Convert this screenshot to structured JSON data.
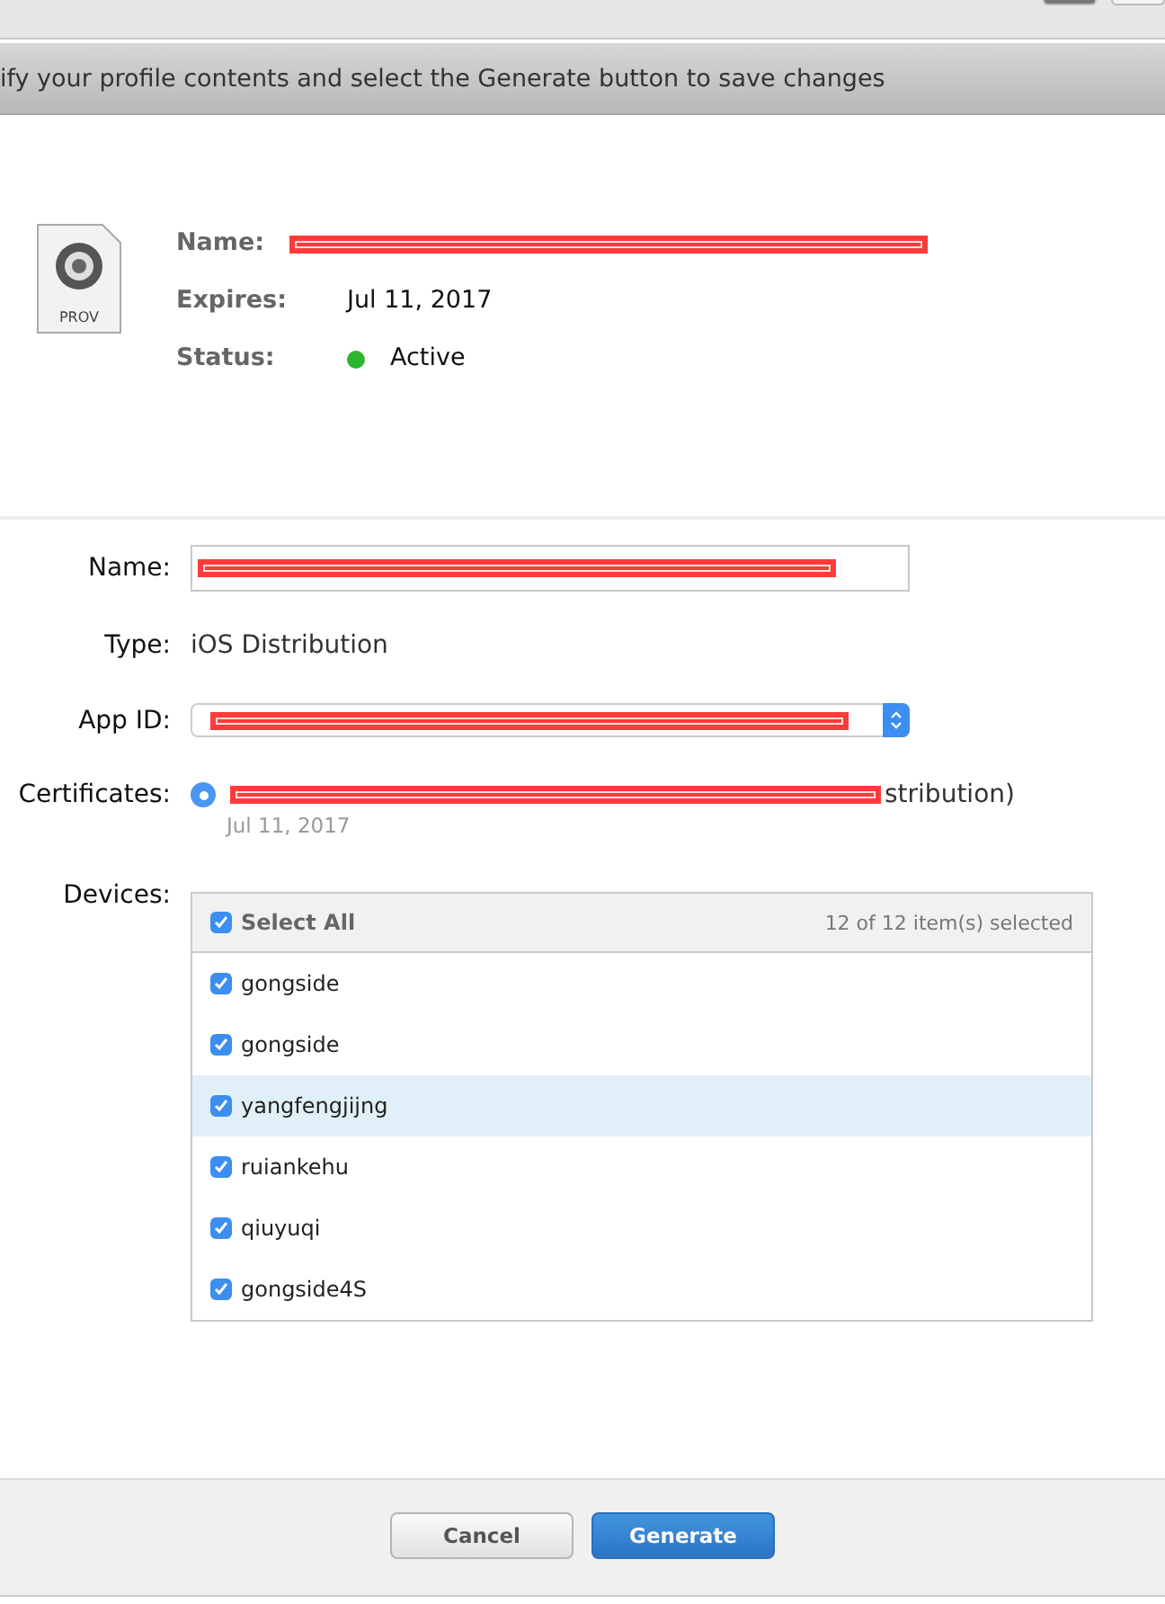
{
  "header": {
    "instruction": "ify your profile contents and select the Generate button to save changes"
  },
  "profile": {
    "icon_label": "PROV",
    "fields": [
      {
        "kind": "redacted",
        "label": "Name:"
      },
      {
        "kind": "text",
        "label": "Expires:",
        "value": "Jul 11, 2017"
      },
      {
        "kind": "status",
        "label": "Status:",
        "value": "Active",
        "color": "#2db52d"
      }
    ]
  },
  "form": {
    "name_label": "Name:",
    "type_label": "Type:",
    "type_value": "iOS Distribution",
    "app_id_label": "App ID:",
    "certificates_label": "Certificates:",
    "certificate": {
      "selected": true,
      "name_visible": "stribution)",
      "date": "Jul 11, 2017"
    },
    "devices_label": "Devices:"
  },
  "devices": {
    "select_all": {
      "label": "Select All",
      "checked": true
    },
    "count": "12 of 12 item(s) selected",
    "items": [
      {
        "name": "gongside",
        "checked": true,
        "highlighted": false
      },
      {
        "name": "gongside",
        "checked": true,
        "highlighted": false
      },
      {
        "name": "yangfengjijng",
        "checked": true,
        "highlighted": true
      },
      {
        "name": "ruiankehu",
        "checked": true,
        "highlighted": false
      },
      {
        "name": "qiuyuqi",
        "checked": true,
        "highlighted": false
      },
      {
        "name": "gongside4S",
        "checked": true,
        "highlighted": false
      }
    ]
  },
  "buttons": [
    {
      "label": "Cancel",
      "kind": "secondary"
    },
    {
      "label": "Generate",
      "kind": "primary"
    }
  ]
}
